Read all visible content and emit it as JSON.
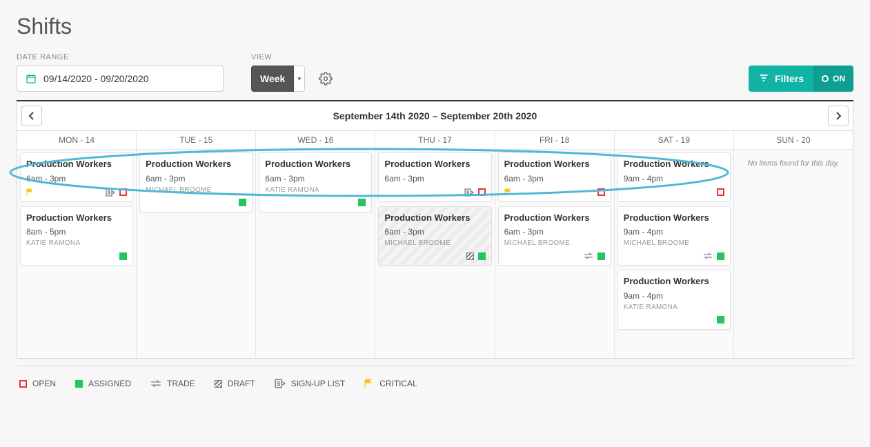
{
  "page": {
    "title": "Shifts"
  },
  "controls": {
    "date_range_label": "DATE RANGE",
    "date_range_value": "09/14/2020 - 09/20/2020",
    "view_label": "VIEW",
    "view_value": "Week",
    "filters_label": "Filters",
    "filters_state": "ON"
  },
  "calendar": {
    "week_title": "September 14th 2020 – September 20th 2020",
    "no_items_text": "No items found for this day.",
    "days": [
      {
        "header": "MON - 14"
      },
      {
        "header": "TUE - 15"
      },
      {
        "header": "WED - 16"
      },
      {
        "header": "THU - 17"
      },
      {
        "header": "FRI - 18"
      },
      {
        "header": "SAT - 19"
      },
      {
        "header": "SUN - 20"
      }
    ],
    "shifts": {
      "mon_0": {
        "title": "Production Workers",
        "time": "6am - 3pm"
      },
      "mon_1": {
        "title": "Production Workers",
        "time": "8am - 5pm",
        "assignee": "KATIE RAMONA"
      },
      "tue_0": {
        "title": "Production Workers",
        "time": "6am - 3pm",
        "assignee": "MICHAEL BROOME"
      },
      "wed_0": {
        "title": "Production Workers",
        "time": "6am - 3pm",
        "assignee": "KATIE RAMONA"
      },
      "thu_0": {
        "title": "Production Workers",
        "time": "6am - 3pm"
      },
      "thu_1": {
        "title": "Production Workers",
        "time": "6am - 3pm",
        "assignee": "MICHAEL BROOME"
      },
      "fri_0": {
        "title": "Production Workers",
        "time": "6am - 3pm"
      },
      "fri_1": {
        "title": "Production Workers",
        "time": "6am - 3pm",
        "assignee": "MICHAEL BROOME"
      },
      "sat_0": {
        "title": "Production Workers",
        "time": "9am - 4pm"
      },
      "sat_1": {
        "title": "Production Workers",
        "time": "9am - 4pm",
        "assignee": "MICHAEL BROOME"
      },
      "sat_2": {
        "title": "Production Workers",
        "time": "9am - 4pm",
        "assignee": "KATIE RAMONA"
      }
    }
  },
  "legend": {
    "open": "OPEN",
    "assigned": "ASSIGNED",
    "trade": "TRADE",
    "draft": "DRAFT",
    "signup": "SIGN-UP LIST",
    "critical": "CRITICAL"
  }
}
